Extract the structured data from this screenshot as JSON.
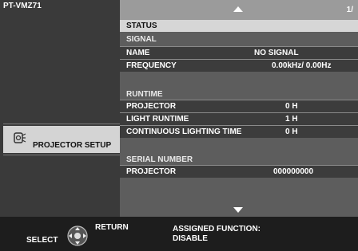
{
  "sidebar": {
    "model": "PT-VMZ71",
    "menu_item": "PROJECTOR SETUP"
  },
  "panel": {
    "page": "1/",
    "status_title": "STATUS",
    "signal": {
      "section": "SIGNAL",
      "rows": [
        {
          "label": "NAME",
          "value": "NO SIGNAL"
        },
        {
          "label": "FREQUENCY",
          "value": "0.00kHz/  0.00Hz"
        }
      ]
    },
    "runtime": {
      "section": "RUNTIME",
      "rows": [
        {
          "label": "PROJECTOR",
          "value": "0  H"
        },
        {
          "label": "LIGHT RUNTIME",
          "value": "1  H"
        },
        {
          "label": "CONTINUOUS LIGHTING TIME",
          "value": "0  H"
        }
      ]
    },
    "serial": {
      "section": "SERIAL NUMBER",
      "rows": [
        {
          "label": "PROJECTOR",
          "value": "000000000"
        }
      ]
    }
  },
  "footer": {
    "select": "SELECT",
    "return": "RETURN",
    "assigned_label": "ASSIGNED FUNCTION:",
    "assigned_value": "DISABLE"
  },
  "icons": {
    "menu_icon": "projector-setup-icon",
    "pad_icon": "directional-pad-icon",
    "up": "up-arrow-icon",
    "down": "down-arrow-icon"
  }
}
